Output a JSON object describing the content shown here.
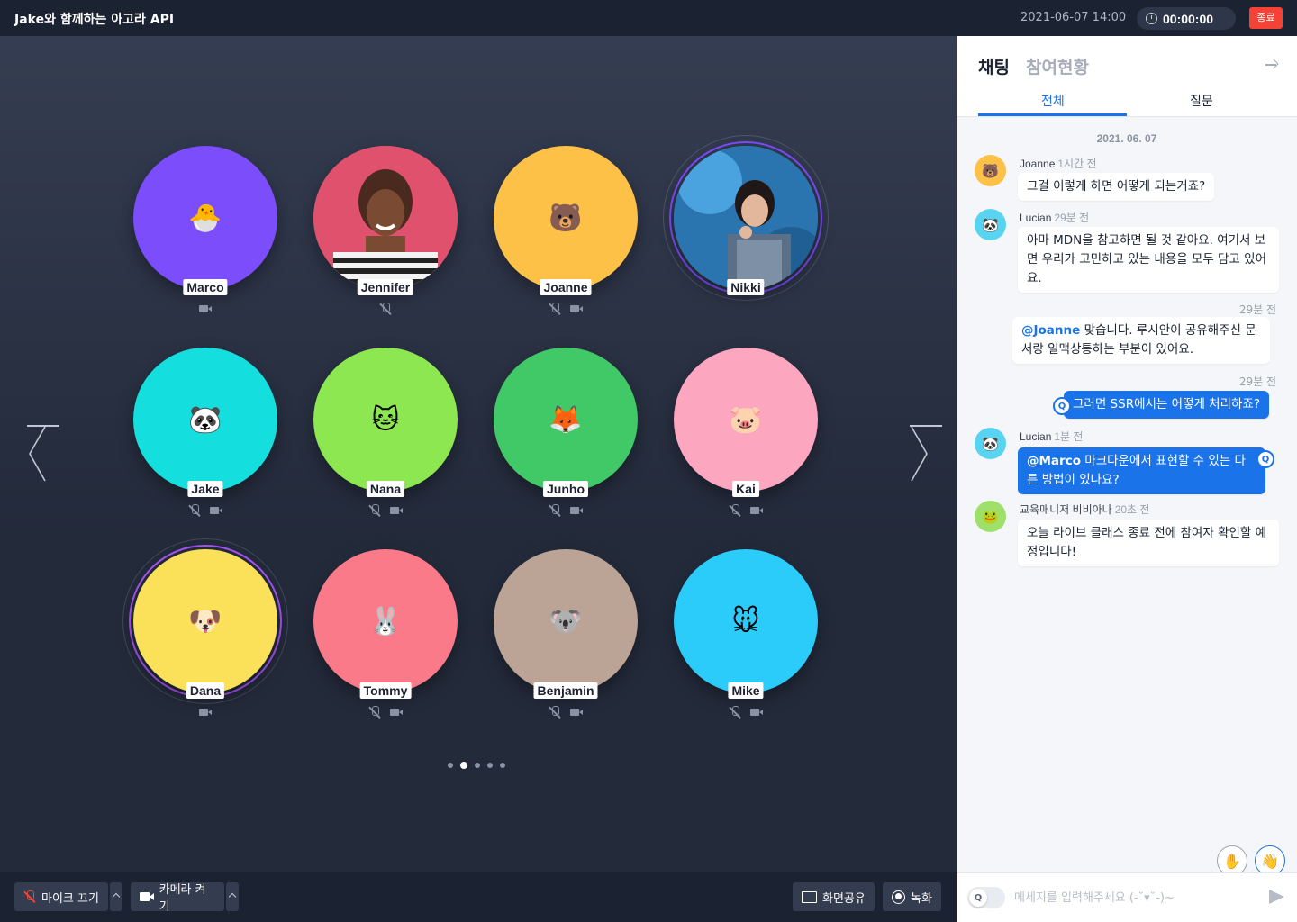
{
  "header": {
    "title": "Jake와 함께하는 아고라 API",
    "datetime": "2021-06-07 14:00",
    "timer": "00:00:00",
    "end_label": "종료"
  },
  "participants": [
    {
      "name": "Marco",
      "emoji": "🐣",
      "color": "#7b4dfb",
      "mic": "on",
      "cam": "off"
    },
    {
      "name": "Jennifer",
      "emoji": "",
      "color": "#e0516d",
      "mic": "off",
      "cam": "on",
      "photo": true
    },
    {
      "name": "Joanne",
      "emoji": "🐻",
      "color": "#fec147",
      "mic": "off",
      "cam": "off"
    },
    {
      "name": "Nikki",
      "emoji": "",
      "color": "#3a8ec9",
      "mic": "on",
      "cam": "on",
      "photo": true,
      "speaking": true
    },
    {
      "name": "Jake",
      "emoji": "🐼",
      "color": "#14dede",
      "mic": "off",
      "cam": "off"
    },
    {
      "name": "Nana",
      "emoji": "🐱",
      "color": "#8ce750",
      "mic": "off",
      "cam": "off"
    },
    {
      "name": "Junho",
      "emoji": "🦊",
      "color": "#40c966",
      "mic": "off",
      "cam": "off"
    },
    {
      "name": "Kai",
      "emoji": "🐷",
      "color": "#fda6c0",
      "mic": "off",
      "cam": "off"
    },
    {
      "name": "Dana",
      "emoji": "🐶",
      "color": "#fbe05a",
      "mic": "on",
      "cam": "off",
      "speaking": true
    },
    {
      "name": "Tommy",
      "emoji": "🐰",
      "color": "#fb7a8a",
      "mic": "off",
      "cam": "off"
    },
    {
      "name": "Benjamin",
      "emoji": "🐨",
      "color": "#bba495",
      "mic": "off",
      "cam": "off"
    },
    {
      "name": "Mike",
      "emoji": "🐭",
      "color": "#2cccfa",
      "mic": "off",
      "cam": "off"
    }
  ],
  "pagination": {
    "total": 5,
    "active": 1
  },
  "controls": {
    "mic_label": "마이크 끄기",
    "camera_label": "카메라 켜기",
    "screen_share_label": "화면공유",
    "record_label": "녹화"
  },
  "panel": {
    "chat_tab": "채팅",
    "participants_tab": "참여현황",
    "subtabs": [
      "전체",
      "질문"
    ],
    "date": "2021. 06. 07",
    "input_placeholder": "메세지를 입력해주세요 (-˘▾˘-)~",
    "q_label": "Q"
  },
  "messages": [
    {
      "author": "Joanne",
      "time": "1시간 전",
      "avatar": "🐻",
      "avatar_color": "#fec147",
      "text": "그걸 이렇게 하면 어떻게 되는거죠?"
    },
    {
      "author": "Lucian",
      "time": "29분 전",
      "avatar": "🐼",
      "avatar_color": "#59d4f0",
      "text_lines": [
        "아마 MDN을 참고하면 될 것 같아요. 여기서 보",
        "면 우리가 고민하고 있는 내용을 모두 담고 있어",
        "요."
      ]
    },
    {
      "own": true,
      "time": "29분 전",
      "mention": "@Joanne",
      "text_lines": [
        " 맞습니다. 루시안이 공유해주신 문",
        "서랑 일맥상통하는 부분이 있어요."
      ]
    },
    {
      "own": true,
      "question": true,
      "time": "29분 전",
      "text": "그러면 SSR에서는 어떻게 처리하죠?"
    },
    {
      "author": "Lucian",
      "time": "1분 전",
      "avatar": "🐼",
      "avatar_color": "#59d4f0",
      "question": true,
      "mention": "@Marco",
      "text_lines": [
        " 마크다운에서 표현할 수 있는 다",
        "른 방법이 있나요?"
      ]
    },
    {
      "author": "교육매니저 비비아나",
      "time": "20초 전",
      "avatar": "🐸",
      "avatar_color": "#9fe06b",
      "text_lines": [
        "오늘 라이브 클래스 종료 전에 참여자 확인할 예",
        "정입니다!"
      ]
    }
  ]
}
